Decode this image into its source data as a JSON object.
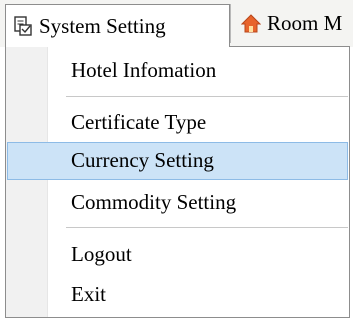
{
  "menubar": {
    "items": [
      {
        "label": "System Setting",
        "icon": "settings-document-icon",
        "state": "open"
      },
      {
        "label": "Room M",
        "icon": "house-icon"
      }
    ]
  },
  "dropdown": {
    "items": [
      {
        "label": "Hotel Infomation"
      },
      {
        "type": "separator"
      },
      {
        "label": "Certificate Type"
      },
      {
        "label": "Currency Setting",
        "state": "highlighted"
      },
      {
        "label": "Commodity Setting"
      },
      {
        "type": "separator"
      },
      {
        "label": "Logout"
      },
      {
        "label": "Exit"
      }
    ]
  },
  "colors": {
    "highlight_fill": "#cce3f7",
    "highlight_border": "#8dbbe6",
    "gutter": "#f1f1f1",
    "house_roof": "#e8642c"
  }
}
